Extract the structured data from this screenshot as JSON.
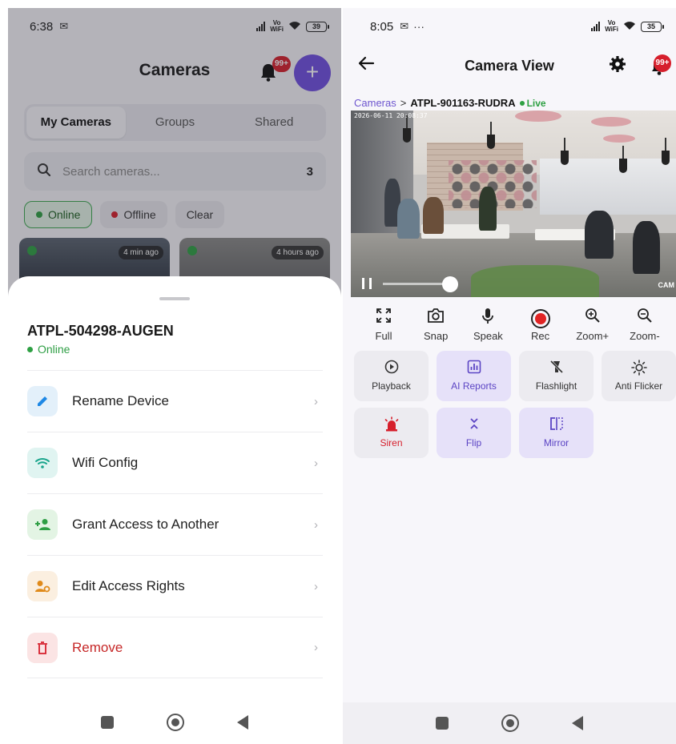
{
  "left": {
    "status": {
      "time": "6:38",
      "battery": "39"
    },
    "header": {
      "title": "Cameras",
      "badge": "99+",
      "add_symbol": "+"
    },
    "tabs": [
      {
        "label": "My Cameras"
      },
      {
        "label": "Groups"
      },
      {
        "label": "Shared"
      }
    ],
    "search": {
      "placeholder": "Search cameras...",
      "count": "3"
    },
    "filters": [
      {
        "label": "Online"
      },
      {
        "label": "Offline"
      },
      {
        "label": "Clear"
      }
    ],
    "thumbs": [
      {
        "ago": "4 min ago"
      },
      {
        "ago": "4 hours ago"
      }
    ],
    "sheet": {
      "device_name": "ATPL-504298-AUGEN",
      "status": "Online",
      "items": [
        {
          "label": "Rename Device",
          "icon": "pencil-icon",
          "bg": "#e3f0fa",
          "fg": "#1e88e5"
        },
        {
          "label": "Wifi Config",
          "icon": "wifi-icon",
          "bg": "#e0f4f1",
          "fg": "#1aa58c"
        },
        {
          "label": "Grant Access to Another",
          "icon": "person-add-icon",
          "bg": "#e3f4e4",
          "fg": "#2e9e44"
        },
        {
          "label": "Edit Access Rights",
          "icon": "person-gear-icon",
          "bg": "#fbefe0",
          "fg": "#e08a1a"
        },
        {
          "label": "Remove",
          "icon": "trash-icon",
          "bg": "#fbe4e4",
          "fg": "#d61f2c"
        }
      ]
    }
  },
  "right": {
    "status": {
      "time": "8:05",
      "battery": "35"
    },
    "header": {
      "title": "Camera View",
      "badge": "99+"
    },
    "breadcrumb": {
      "root": "Cameras",
      "separator": ">",
      "current": "ATPL-901163-RUDRA",
      "live": "Live"
    },
    "video": {
      "timestamp": "2026-06-11 20:08:37"
    },
    "toolbar": [
      {
        "label": "Full",
        "icon": "fullscreen-icon"
      },
      {
        "label": "Snap",
        "icon": "camera-icon"
      },
      {
        "label": "Speak",
        "icon": "microphone-icon"
      },
      {
        "label": "Rec",
        "icon": "record-icon"
      },
      {
        "label": "Zoom+",
        "icon": "zoom-in-icon"
      },
      {
        "label": "Zoom-",
        "icon": "zoom-out-icon"
      }
    ],
    "grid": [
      {
        "label": "Playback",
        "icon": "play-icon"
      },
      {
        "label": "AI Reports",
        "icon": "chart-icon"
      },
      {
        "label": "Flashlight",
        "icon": "flashlight-off-icon"
      },
      {
        "label": "Anti Flicker",
        "icon": "sun-icon"
      },
      {
        "label": "Siren",
        "icon": "siren-icon"
      },
      {
        "label": "Flip",
        "icon": "flip-icon"
      },
      {
        "label": "Mirror",
        "icon": "mirror-icon"
      }
    ]
  }
}
